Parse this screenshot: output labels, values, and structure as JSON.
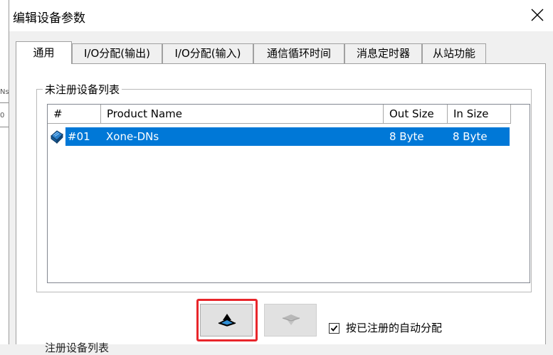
{
  "background_window": {
    "fragments": [
      "Ns",
      "0"
    ]
  },
  "dialog": {
    "title": "编辑设备参数",
    "close_label": "close"
  },
  "tabs": [
    {
      "label": "通用",
      "active": true
    },
    {
      "label": "I/O分配(输出)",
      "active": false
    },
    {
      "label": "I/O分配(输入)",
      "active": false
    },
    {
      "label": "通信循环时间",
      "active": false
    },
    {
      "label": "消息定时器",
      "active": false
    },
    {
      "label": "从站功能",
      "active": false
    }
  ],
  "unregistered_group": {
    "label": "未注册设备列表",
    "columns": [
      "#",
      "Product Name",
      "Out Size",
      "In Size"
    ],
    "rows": [
      {
        "icon": "device-icon",
        "number": "#01",
        "product_name": "Xone-DNs",
        "out_size": "8 Byte",
        "in_size": "8 Byte",
        "selected": true
      }
    ]
  },
  "buttons": {
    "add_icon": "register-down-icon",
    "remove_icon": "unregister-up-icon"
  },
  "auto_assign": {
    "label": "按已注册的自动分配",
    "checked": true
  },
  "registered_group": {
    "label_partial": "注册设备列表"
  },
  "colors": {
    "selection": "#0078d7",
    "highlight_box": "#e8262b"
  }
}
